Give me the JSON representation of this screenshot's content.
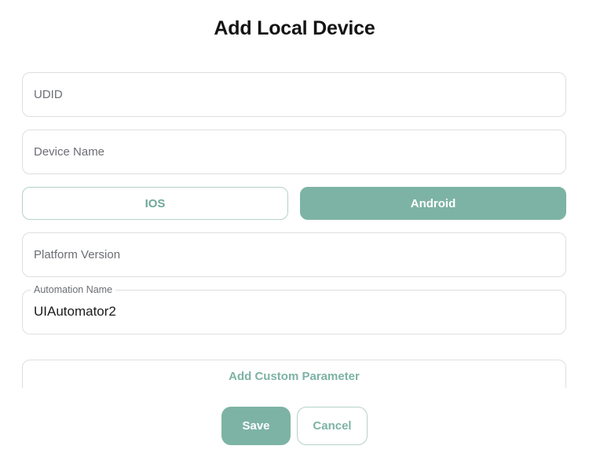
{
  "dialog": {
    "title": "Add Local Device"
  },
  "form": {
    "udid_placeholder": "UDID",
    "device_name_placeholder": "Device Name",
    "platform": {
      "ios_label": "IOS",
      "android_label": "Android",
      "selected": "Android"
    },
    "platform_version_placeholder": "Platform Version",
    "automation_name": {
      "label": "Automation Name",
      "value": "UIAutomator2"
    },
    "add_custom_parameter_label": "Add Custom Parameter"
  },
  "actions": {
    "save_label": "Save",
    "cancel_label": "Cancel"
  },
  "colors": {
    "accent": "#7db3a4",
    "accent_border": "#b4d2c9",
    "field_border": "#dcdfe2",
    "title": "#141414"
  }
}
